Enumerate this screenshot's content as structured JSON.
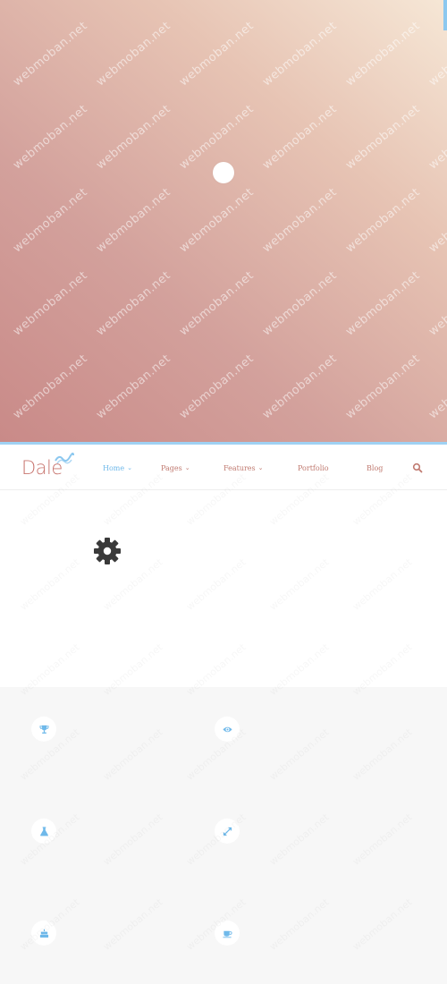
{
  "hero": {
    "watermark": "webmoban.net"
  },
  "brand": {
    "logo_text": "Dale",
    "accent_color": "#6fb9ea",
    "link_color": "#c07a70"
  },
  "nav": {
    "items": [
      {
        "label": "Home",
        "has_dropdown": true,
        "active": true
      },
      {
        "label": "Pages",
        "has_dropdown": true,
        "active": false
      },
      {
        "label": "Features",
        "has_dropdown": true,
        "active": false
      },
      {
        "label": "Portfolio",
        "has_dropdown": false,
        "active": false
      },
      {
        "label": "Blog",
        "has_dropdown": false,
        "active": false
      }
    ],
    "chevron": "⌄",
    "search_icon": "search-icon"
  },
  "about": {
    "icon": "gear-icon"
  },
  "features": {
    "icons": [
      "trophy-icon",
      "eye-icon",
      "flask-icon",
      "expand-icon",
      "cake-icon",
      "coffee-icon"
    ]
  }
}
